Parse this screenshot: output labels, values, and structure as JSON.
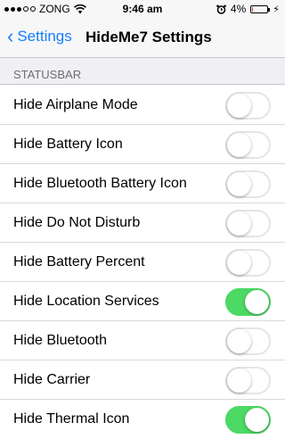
{
  "status_bar": {
    "carrier": "ZONG",
    "time": "9:46 am",
    "battery_percent": "4%",
    "battery_level": 0.04,
    "battery_color": "#e0312b"
  },
  "nav": {
    "back_label": "Settings",
    "title": "HideMe7 Settings",
    "accent_color": "#147efb"
  },
  "section": {
    "header": "STATUSBAR"
  },
  "rows": [
    {
      "label": "Hide Airplane Mode",
      "on": false
    },
    {
      "label": "Hide Battery Icon",
      "on": false
    },
    {
      "label": "Hide Bluetooth Battery Icon",
      "on": false
    },
    {
      "label": "Hide Do Not Disturb",
      "on": false
    },
    {
      "label": "Hide Battery Percent",
      "on": false
    },
    {
      "label": "Hide Location Services",
      "on": true
    },
    {
      "label": "Hide Bluetooth",
      "on": false
    },
    {
      "label": "Hide Carrier",
      "on": false
    },
    {
      "label": "Hide Thermal Icon",
      "on": true
    }
  ],
  "toggle_on_color": "#4cd964"
}
